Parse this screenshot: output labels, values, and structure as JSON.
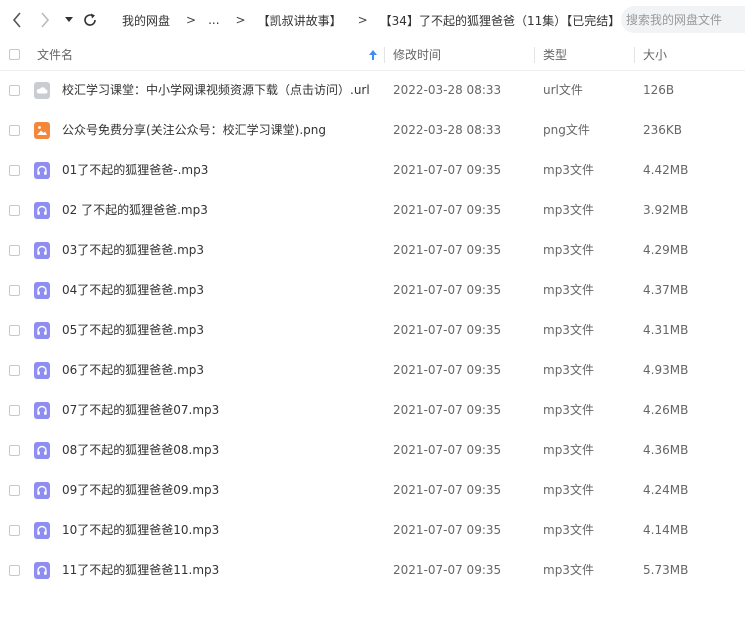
{
  "toolbar": {
    "back_icon": "chevron-left-icon",
    "forward_icon": "chevron-right-icon",
    "history_icon": "caret-down-icon",
    "refresh_icon": "refresh-icon"
  },
  "breadcrumb": {
    "items": [
      "我的网盘",
      "...",
      "【凯叔讲故事】",
      "【34】了不起的狐狸爸爸（11集）【已完结】"
    ],
    "separator": ">"
  },
  "search": {
    "placeholder": "搜索我的网盘文件"
  },
  "table": {
    "headers": {
      "name": "文件名",
      "modified": "修改时间",
      "type": "类型",
      "size": "大小"
    },
    "sort_icon": "arrow-up-icon",
    "rows": [
      {
        "name": "校汇学习课堂：中小学网课视频资源下载（点击访问）.url",
        "modified": "2022-03-28 08:33",
        "type": "url文件",
        "size": "126B",
        "icon": "cloud-icon",
        "icon_color": "#c9ccd1"
      },
      {
        "name": "公众号免费分享(关注公众号：校汇学习课堂).png",
        "modified": "2022-03-28 08:33",
        "type": "png文件",
        "size": "236KB",
        "icon": "image-icon",
        "icon_color": "#f5873a"
      },
      {
        "name": "01了不起的狐狸爸爸-.mp3",
        "modified": "2021-07-07 09:35",
        "type": "mp3文件",
        "size": "4.42MB",
        "icon": "headphones-icon",
        "icon_color": "#8d8df2"
      },
      {
        "name": "02 了不起的狐狸爸爸.mp3",
        "modified": "2021-07-07 09:35",
        "type": "mp3文件",
        "size": "3.92MB",
        "icon": "headphones-icon",
        "icon_color": "#8d8df2"
      },
      {
        "name": "03了不起的狐狸爸爸.mp3",
        "modified": "2021-07-07 09:35",
        "type": "mp3文件",
        "size": "4.29MB",
        "icon": "headphones-icon",
        "icon_color": "#8d8df2"
      },
      {
        "name": "04了不起的狐狸爸爸.mp3",
        "modified": "2021-07-07 09:35",
        "type": "mp3文件",
        "size": "4.37MB",
        "icon": "headphones-icon",
        "icon_color": "#8d8df2"
      },
      {
        "name": "05了不起的狐狸爸爸.mp3",
        "modified": "2021-07-07 09:35",
        "type": "mp3文件",
        "size": "4.31MB",
        "icon": "headphones-icon",
        "icon_color": "#8d8df2"
      },
      {
        "name": "06了不起的狐狸爸爸.mp3",
        "modified": "2021-07-07 09:35",
        "type": "mp3文件",
        "size": "4.93MB",
        "icon": "headphones-icon",
        "icon_color": "#8d8df2"
      },
      {
        "name": "07了不起的狐狸爸爸07.mp3",
        "modified": "2021-07-07 09:35",
        "type": "mp3文件",
        "size": "4.26MB",
        "icon": "headphones-icon",
        "icon_color": "#8d8df2"
      },
      {
        "name": "08了不起的狐狸爸爸08.mp3",
        "modified": "2021-07-07 09:35",
        "type": "mp3文件",
        "size": "4.36MB",
        "icon": "headphones-icon",
        "icon_color": "#8d8df2"
      },
      {
        "name": "09了不起的狐狸爸爸09.mp3",
        "modified": "2021-07-07 09:35",
        "type": "mp3文件",
        "size": "4.24MB",
        "icon": "headphones-icon",
        "icon_color": "#8d8df2"
      },
      {
        "name": "10了不起的狐狸爸爸10.mp3",
        "modified": "2021-07-07 09:35",
        "type": "mp3文件",
        "size": "4.14MB",
        "icon": "headphones-icon",
        "icon_color": "#8d8df2"
      },
      {
        "name": "11了不起的狐狸爸爸11.mp3",
        "modified": "2021-07-07 09:35",
        "type": "mp3文件",
        "size": "5.73MB",
        "icon": "headphones-icon",
        "icon_color": "#8d8df2"
      }
    ]
  }
}
